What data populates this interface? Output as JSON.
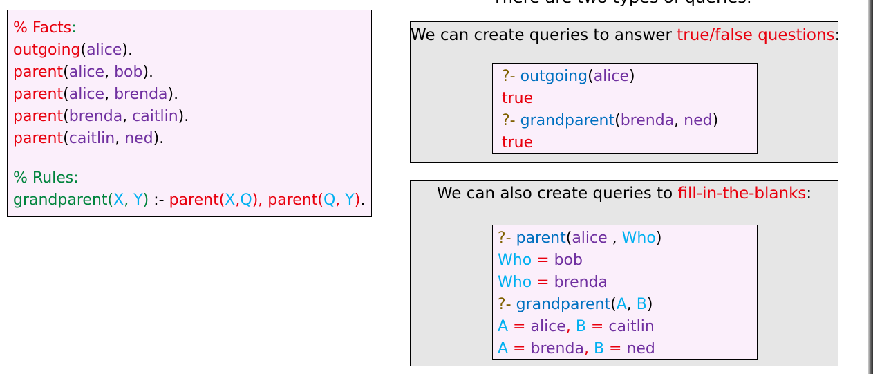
{
  "heading": "There are two types of queries:",
  "facts": {
    "facts_comment": "% Facts",
    "colon": ":",
    "lines": [
      {
        "pred": "outgoing",
        "open": "(",
        "a1": "alice",
        "sep": "",
        "a2": "",
        "close": ")."
      },
      {
        "pred": "parent",
        "open": "(",
        "a1": "alice",
        "sep": ", ",
        "a2": "bob",
        "close": ")."
      },
      {
        "pred": "parent",
        "open": "(",
        "a1": "alice",
        "sep": ", ",
        "a2": "brenda",
        "close": ")."
      },
      {
        "pred": "parent",
        "open": "(",
        "a1": "brenda",
        "sep": ", ",
        "a2": "caitlin",
        "close": ")."
      },
      {
        "pred": "parent",
        "open": "(",
        "a1": "caitlin",
        "sep": ", ",
        "a2": "ned",
        "close": ")."
      }
    ],
    "rules_comment": "% Rules",
    "rule": {
      "head": "grandparent(",
      "v1": "X",
      "c1": ", ",
      "v2": "Y",
      "head_close": ")",
      "neck": " :- ",
      "b1": "parent(",
      "b1v1": "X",
      "b1c": ",",
      "b1v2": "Q",
      "b1close": "), parent(",
      "b2v1": "Q",
      "b2c": ", ",
      "b2v2": "Y",
      "b2close": ")",
      "end": "."
    }
  },
  "panel1": {
    "intro": "We can create queries to answer ",
    "highlight": "true/false questions",
    "colon": ":",
    "lines": [
      {
        "prompt": "?- ",
        "pred": "outgoing",
        "open": "(",
        "a1": "alice",
        "sep": "",
        "a2": "",
        "close": ")"
      },
      {
        "answer": "true"
      },
      {
        "prompt": "?- ",
        "pred": "grandparent",
        "open": "(",
        "a1": "brenda",
        "sep": ", ",
        "a2": "ned",
        "close": ")"
      },
      {
        "answer": "true"
      }
    ]
  },
  "panel2": {
    "intro": "We can also create queries to ",
    "highlight": "fill-in-the-blanks",
    "colon": ":",
    "q1": {
      "prompt": "?- ",
      "pred": "parent",
      "open": "(",
      "a1": "alice",
      "sep": " , ",
      "v": "Who",
      "close": ")"
    },
    "a1": {
      "v": "Who",
      "eq": " = ",
      "val": "bob"
    },
    "a2": {
      "v": "Who",
      "eq": " = ",
      "val": "brenda"
    },
    "q2": {
      "prompt": "?- ",
      "pred": "grandparent",
      "open": "(",
      "v1": "A",
      "sep": ", ",
      "v2": "B",
      "close": ")"
    },
    "a3": {
      "v1": "A",
      "eq1": " = ",
      "val1": "alice",
      "comma": ", ",
      "v2": "B",
      "eq2": " = ",
      "val2": "caitlin"
    },
    "a4": {
      "v1": "A",
      "eq1": " = ",
      "val1": "brenda",
      "comma": ", ",
      "v2": "B",
      "eq2": " = ",
      "val2": "ned"
    }
  },
  "colors": {
    "comment": "#00843d",
    "predicate": "#e8000e",
    "atom": "#7030a0",
    "variable": "#00b0f0",
    "prompt": "#7f6000",
    "query_predicate": "#0070c0",
    "panel_bg": "#e6e6e6",
    "code_bg": "#fbeffb"
  }
}
